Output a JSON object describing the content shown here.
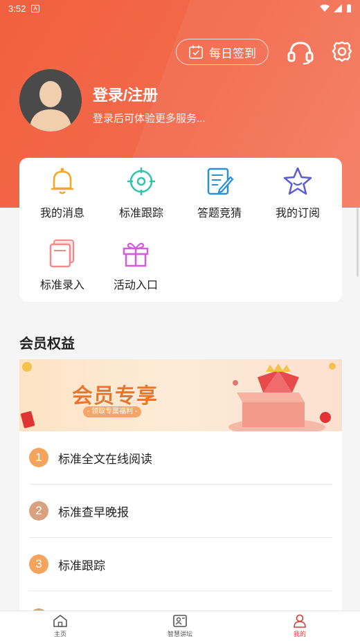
{
  "status_bar": {
    "time": "3:52",
    "badge": "A"
  },
  "header": {
    "checkin_label": "每日签到",
    "login_title": "登录/注册",
    "login_subtitle": "登录后可体验更多服务..."
  },
  "menu": [
    {
      "label": "我的消息",
      "icon": "bell-icon"
    },
    {
      "label": "标准跟踪",
      "icon": "target-icon"
    },
    {
      "label": "答题竞猜",
      "icon": "edit-doc-icon"
    },
    {
      "label": "我的订阅",
      "icon": "star-icon"
    },
    {
      "label": "标准录入",
      "icon": "documents-icon"
    },
    {
      "label": "活动入口",
      "icon": "gift-icon"
    }
  ],
  "membership": {
    "section_title": "会员权益",
    "banner_title": "会员专享",
    "banner_subtitle": "- 领取专属福利 -",
    "benefits": [
      {
        "number": "1",
        "label": "标准全文在线阅读",
        "color": "#f6a35c"
      },
      {
        "number": "2",
        "label": "标准查早晚报",
        "color": "#d9a27e"
      },
      {
        "number": "3",
        "label": "标准跟踪",
        "color": "#f6a35c"
      }
    ]
  },
  "tabs": [
    {
      "label": "主页",
      "icon": "home-icon"
    },
    {
      "label": "智慧讲坛",
      "icon": "lecture-icon"
    },
    {
      "label": "我的",
      "icon": "user-icon",
      "active": true
    }
  ],
  "colors": {
    "brand": "#f0603f",
    "active_tab": "#d93a3a"
  }
}
